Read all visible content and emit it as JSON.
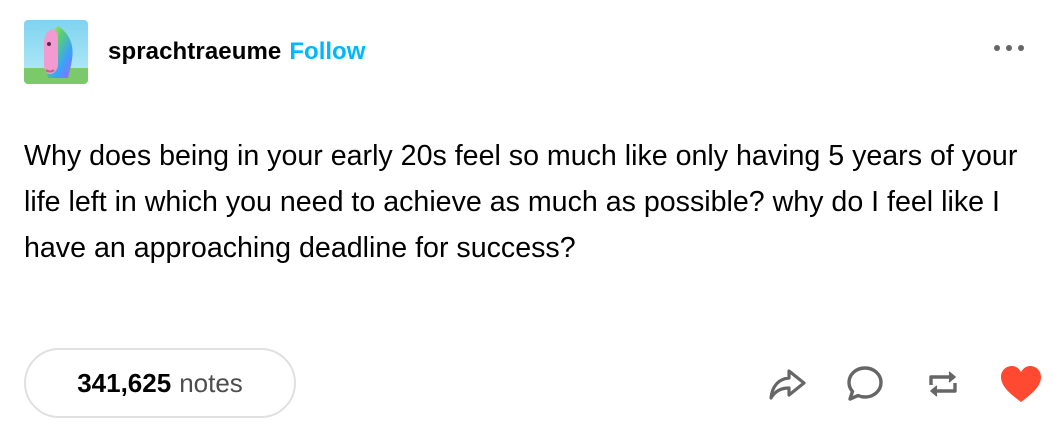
{
  "post": {
    "blog_name": "sprachtraeume",
    "follow_label": "Follow",
    "body_text": "Why does being in your early 20s feel so much like only having 5 years of your life left in which you need to achieve as much as possible? why do I feel like I have an approaching deadline for success?",
    "notes_count": "341,625",
    "notes_label": "notes"
  },
  "icons": {
    "more": "more-horizontal-icon",
    "share": "share-icon",
    "reply": "reply-icon",
    "reblog": "reblog-icon",
    "like": "heart-icon"
  },
  "colors": {
    "follow": "#00b8ff",
    "heart": "#ff4930",
    "icon": "#666666",
    "pill_border": "#e0e0e0"
  }
}
